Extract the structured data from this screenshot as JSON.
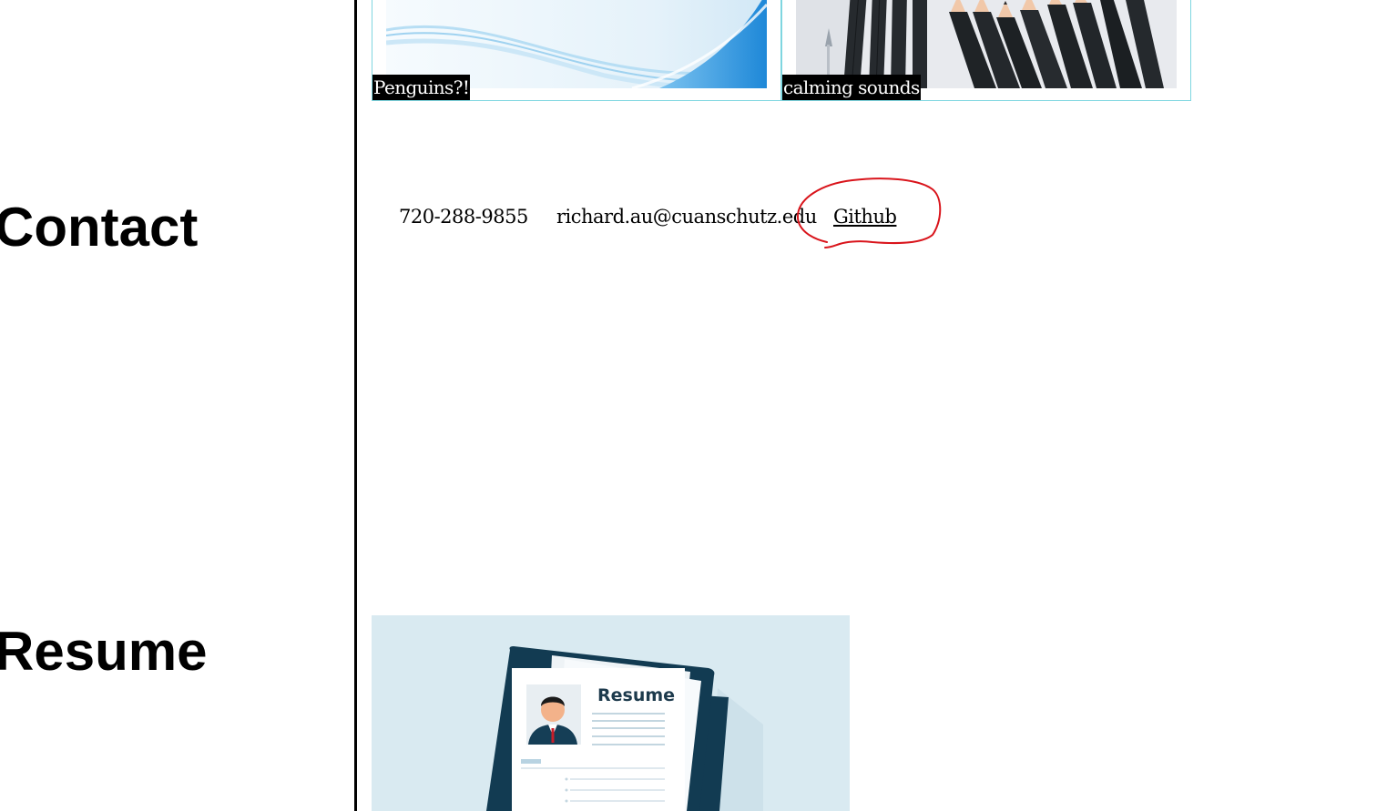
{
  "projects": [
    {
      "caption": "Penguins?!"
    },
    {
      "caption": "calming sounds"
    }
  ],
  "contact": {
    "heading": "Contact",
    "phone": "720-288-9855",
    "email": "richard.au@cuanschutz.edu",
    "github_label": "Github"
  },
  "resume": {
    "heading": "Resume",
    "image_text": "Resume"
  },
  "colors": {
    "card_border": "#7fd6e0",
    "annotation": "#d9141b",
    "resume_bg": "#d9eaf1",
    "clipboard": "#123b52"
  }
}
